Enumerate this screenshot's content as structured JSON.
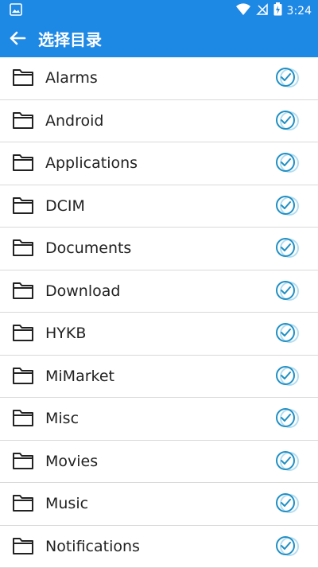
{
  "status_bar": {
    "time": "3:24",
    "icons": [
      "gallery-icon",
      "wifi-icon",
      "no-signal-icon",
      "battery-charging-icon"
    ]
  },
  "app_bar": {
    "title": "选择目录",
    "back_icon": "arrow-left-icon",
    "color": "#1e88e5"
  },
  "folders": [
    {
      "name": "Alarms"
    },
    {
      "name": "Android"
    },
    {
      "name": "Applications"
    },
    {
      "name": "DCIM"
    },
    {
      "name": "Documents"
    },
    {
      "name": "Download"
    },
    {
      "name": "HYKB"
    },
    {
      "name": "MiMarket"
    },
    {
      "name": "Misc"
    },
    {
      "name": "Movies"
    },
    {
      "name": "Music"
    },
    {
      "name": "Notifications"
    }
  ],
  "row_icons": {
    "folder": "folder-icon",
    "select": "check-circle-icon"
  },
  "accent_color": "#1e88e5"
}
